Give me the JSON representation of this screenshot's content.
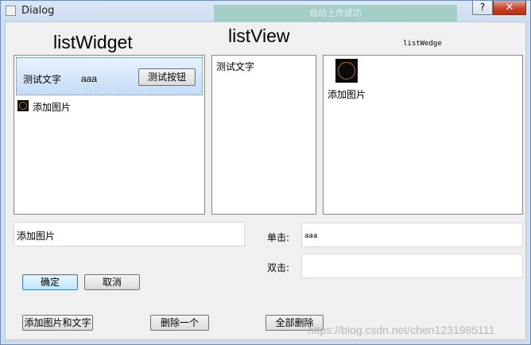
{
  "window": {
    "title": "Dialog",
    "help_label": "?",
    "close_label": "✕",
    "background_overlay_text": "启动上传成功"
  },
  "headings": {
    "list_widget": "listWidget",
    "list_view": "listView",
    "list_wedge": "listWedge"
  },
  "list_widget": {
    "row1_text": "测试文字",
    "row1_value": "aaa",
    "row1_button": "测试按钮",
    "row2_text": "添加图片"
  },
  "list_view": {
    "item1": "测试文字"
  },
  "list_wedge": {
    "item1": "添加图片"
  },
  "inputs": {
    "image_name_value": "添加图片",
    "single_click_label": "单击:",
    "single_click_value": "aaa",
    "double_click_label": "双击:",
    "double_click_value": ""
  },
  "buttons": {
    "ok": "确定",
    "cancel": "取消",
    "add_image_text": "添加图片和文字",
    "delete_one": "删除一个",
    "delete_all": "全部删除"
  },
  "watermark": "https://blog.csdn.net/chen1231985111"
}
